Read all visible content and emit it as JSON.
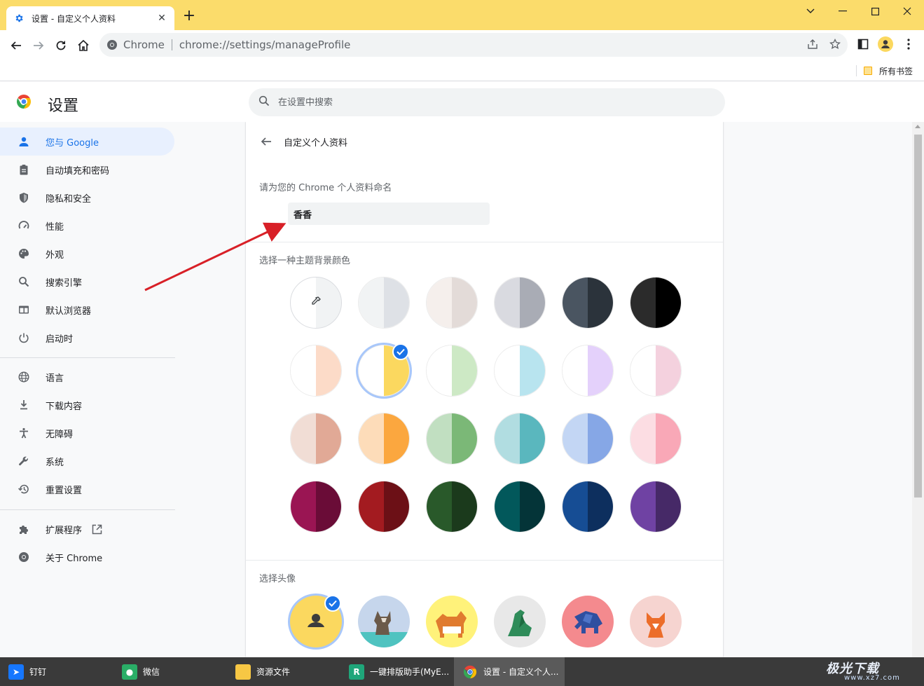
{
  "browser": {
    "tab": {
      "title": "设置 - 自定义个人资料",
      "close_label": "✕"
    },
    "newtab_label": "+",
    "window_controls": {
      "collapse": "⌄",
      "minimize": "—",
      "maximize": "☐",
      "close": "✕"
    },
    "omnibox": {
      "site_name": "Chrome",
      "url": "chrome://settings/manageProfile"
    },
    "bookmarks": {
      "folder_label": "所有书签"
    }
  },
  "settings": {
    "title": "设置",
    "search_placeholder": "在设置中搜索"
  },
  "sidebar": {
    "items": [
      {
        "label": "您与 Google",
        "icon": "person-icon",
        "active": true
      },
      {
        "label": "自动填充和密码",
        "icon": "clipboard-icon"
      },
      {
        "label": "隐私和安全",
        "icon": "shield-icon"
      },
      {
        "label": "性能",
        "icon": "speedometer-icon"
      },
      {
        "label": "外观",
        "icon": "palette-icon"
      },
      {
        "label": "搜索引擎",
        "icon": "search-icon"
      },
      {
        "label": "默认浏览器",
        "icon": "browser-icon"
      },
      {
        "label": "启动时",
        "icon": "power-icon"
      },
      {
        "label": "语言",
        "icon": "globe-icon"
      },
      {
        "label": "下载内容",
        "icon": "download-icon"
      },
      {
        "label": "无障碍",
        "icon": "accessibility-icon"
      },
      {
        "label": "系统",
        "icon": "wrench-icon"
      },
      {
        "label": "重置设置",
        "icon": "history-icon"
      },
      {
        "label": "扩展程序",
        "icon": "puzzle-icon"
      },
      {
        "label": "关于 Chrome",
        "icon": "chrome-icon"
      }
    ]
  },
  "main": {
    "page_title": "自定义个人资料",
    "name_section_label": "请为您的 Chrome 个人资料命名",
    "profile_name": "香香",
    "color_section_label": "选择一种主题背景颜色",
    "colors": [
      [
        "picker",
        "#f1f3f4",
        "#dee1e6",
        "#f5efec",
        "#e3dbd8",
        "#d9dae0",
        "#a9acb5",
        "#4a5561",
        "#2b333b",
        "#2b2b2b",
        "#000000"
      ],
      [
        "#ffffff",
        "#fcdbc8",
        "#ffffff",
        "#fbd85f",
        "#ffffff",
        "#cde9c5",
        "#ffffff",
        "#b8e4ef",
        "#ffffff",
        "#e4d1fb",
        "#ffffff",
        "#f4d1de"
      ],
      [
        "#f1ddd5",
        "#e1a996",
        "#fddcb9",
        "#fba73f",
        "#c1dfc1",
        "#7bb877",
        "#b1dde1",
        "#5ab7be",
        "#c3d6f4",
        "#86a7e6",
        "#fcdde3",
        "#f9a8b7"
      ],
      [
        "#9a1553",
        "#6a0c37",
        "#a31b20",
        "#6c1016",
        "#29592a",
        "#1b3a1c",
        "#02585b",
        "#043438",
        "#164d94",
        "#0d2f5e",
        "#6f42a3",
        "#462967"
      ]
    ],
    "selected_color_index": 7,
    "avatar_section_label": "选择头像",
    "avatars": [
      "默认头像",
      "猫",
      "柯基犬",
      "恐龙",
      "大象",
      "狐狸"
    ]
  },
  "taskbar": {
    "items": [
      {
        "label": "钉钉"
      },
      {
        "label": "微信"
      },
      {
        "label": "资源文件"
      },
      {
        "label": "一键排版助手(MyE..."
      },
      {
        "label": "设置 - 自定义个人..."
      }
    ]
  },
  "watermark": {
    "main": "极光下载",
    "url": "www.xz7.com"
  }
}
